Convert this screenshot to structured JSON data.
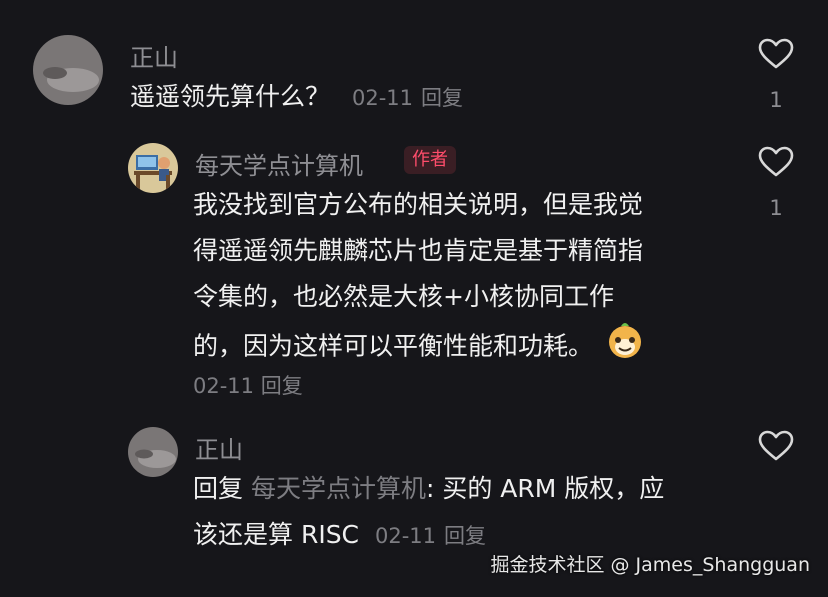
{
  "comments": [
    {
      "username": "正山",
      "text": "遥遥领先算什么？",
      "date": "02-11",
      "reply_label": "回复",
      "likes": "1"
    },
    {
      "username": "每天学点计算机",
      "author_badge": "作者",
      "lines": [
        "我没找到官方公布的相关说明，但是我觉",
        "得遥遥领先麒麟芯片也肯定是基于精简指",
        "令集的，也必然是大核+小核协同工作",
        "的，因为这样可以平衡性能和功耗。"
      ],
      "date": "02-11",
      "reply_label": "回复",
      "likes": "1",
      "emoji": "smiling-mascot-emoji"
    },
    {
      "username": "正山",
      "reply_prefix": "回复",
      "mention": "每天学点计算机",
      "line1_rest": ": 买的 ARM 版权，应",
      "line2": "该还是算 RISC",
      "date": "02-11",
      "reply_label": "回复"
    }
  ],
  "watermark": "掘金技术社区 @ James_Shangguan",
  "colors": {
    "background": "#16161a",
    "badge_text": "#ff4d6b",
    "badge_bg": "#3a1e24",
    "muted": "#7d7d82"
  },
  "icons": {
    "like": "heart-outline-icon"
  }
}
